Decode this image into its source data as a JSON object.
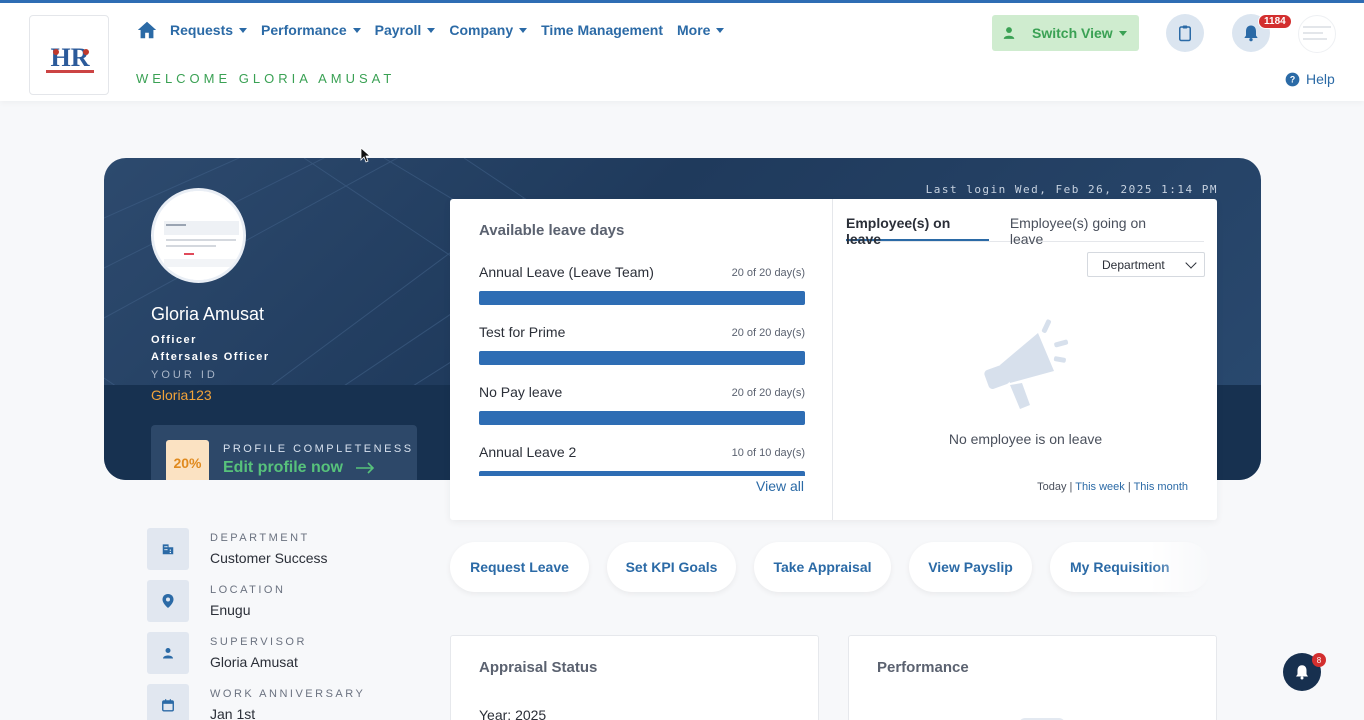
{
  "header": {
    "logo_text": "HR",
    "nav": [
      {
        "label": "Requests",
        "dropdown": true
      },
      {
        "label": "Performance",
        "dropdown": true
      },
      {
        "label": "Payroll",
        "dropdown": true
      },
      {
        "label": "Company",
        "dropdown": true
      },
      {
        "label": "Time Management",
        "dropdown": false
      },
      {
        "label": "More",
        "dropdown": true
      }
    ],
    "welcome": "WELCOME GLORIA AMUSAT",
    "switch_view": "Switch View",
    "notification_count": "1184",
    "help": "Help"
  },
  "hero": {
    "last_login": "Last login Wed, Feb 26, 2025 1:14 PM",
    "name": "Gloria Amusat",
    "role": "Officer",
    "title": "Aftersales Officer",
    "id_label": "YOUR ID",
    "id_value": "Gloria123",
    "profile_label": "PROFILE COMPLETENESS",
    "profile_percent": "20%",
    "profile_cta": "Edit profile now"
  },
  "leave": {
    "title": "Available leave days",
    "items": [
      {
        "name": "Annual Leave (Leave Team)",
        "count": "20 of 20 day(s)",
        "fraction": 1.0
      },
      {
        "name": "Test for Prime",
        "count": "20 of 20 day(s)",
        "fraction": 1.0
      },
      {
        "name": "No Pay leave",
        "count": "20 of 20 day(s)",
        "fraction": 1.0
      },
      {
        "name": "Annual Leave 2",
        "count": "10 of 10 day(s)",
        "fraction": 1.0
      }
    ],
    "view_all": "View all",
    "tabs": [
      "Employee(s) on leave",
      "Employee(s) going on leave"
    ],
    "filter": "Department",
    "empty_text": "No employee is on leave",
    "periods": [
      "Today",
      "This week",
      "This month"
    ]
  },
  "info": [
    {
      "label": "DEPARTMENT",
      "value": "Customer Success",
      "icon": "building-icon"
    },
    {
      "label": "LOCATION",
      "value": "Enugu",
      "icon": "location-pin-icon"
    },
    {
      "label": "SUPERVISOR",
      "value": "Gloria Amusat",
      "icon": "person-icon"
    },
    {
      "label": "WORK ANNIVERSARY",
      "value": "Jan 1st",
      "icon": "calendar-icon"
    }
  ],
  "quick_actions": [
    "Request Leave",
    "Set KPI Goals",
    "Take Appraisal",
    "View Payslip",
    "My Requisition"
  ],
  "cards": {
    "appraisal_title": "Appraisal Status",
    "appraisal_year": "Year: 2025",
    "performance_title": "Performance"
  },
  "floating_badge": "8",
  "colors": {
    "primary": "#2b6aa6",
    "accent_green": "#3aa154",
    "hero_bg": "#1f3a5c",
    "bar": "#2e6db4"
  }
}
